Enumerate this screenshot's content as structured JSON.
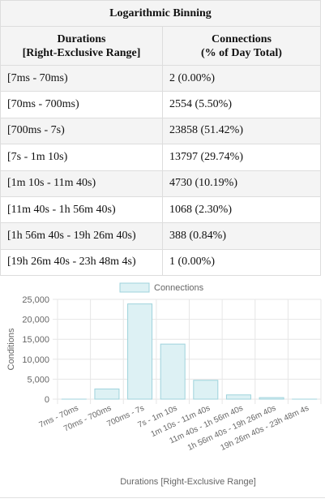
{
  "table": {
    "title": "Logarithmic Binning",
    "col1_line1": "Durations",
    "col1_line2": "[Right-Exclusive Range]",
    "col2_line1": "Connections",
    "col2_line2": "(% of Day Total)",
    "rows": [
      {
        "range": "[7ms - 70ms)",
        "value": "2 (0.00%)"
      },
      {
        "range": "[70ms - 700ms)",
        "value": "2554 (5.50%)"
      },
      {
        "range": "[700ms - 7s)",
        "value": "23858 (51.42%)"
      },
      {
        "range": "[7s - 1m 10s)",
        "value": "13797 (29.74%)"
      },
      {
        "range": "[1m 10s - 11m 40s)",
        "value": "4730 (10.19%)"
      },
      {
        "range": "[11m 40s - 1h 56m 40s)",
        "value": "1068 (2.30%)"
      },
      {
        "range": "[1h 56m 40s - 19h 26m 40s)",
        "value": "388 (0.84%)"
      },
      {
        "range": "[19h 26m 40s - 23h 48m 4s)",
        "value": "1 (0.00%)"
      }
    ]
  },
  "chart_data": {
    "type": "bar",
    "categories": [
      "7ms - 70ms",
      "70ms - 700ms",
      "700ms - 7s",
      "7s - 1m 10s",
      "1m 10s - 11m 40s",
      "11m 40s - 1h 56m 40s",
      "1h 56m 40s - 19h 26m 40s",
      "19h 26m 40s - 23h 48m 4s"
    ],
    "series": [
      {
        "name": "Connections",
        "values": [
          2,
          2554,
          23858,
          13797,
          4730,
          1068,
          388,
          1
        ]
      }
    ],
    "xlabel": "Durations [Right-Exclusive Range]",
    "ylabel": "Conditions",
    "ylim": [
      0,
      25000
    ],
    "yticks": [
      "0",
      "5,000",
      "10,000",
      "15,000",
      "20,000",
      "25,000"
    ],
    "legend": "top",
    "grid": true,
    "colors": {
      "bar_fill": "#ddf1f4",
      "bar_stroke": "#9fd3dc",
      "grid": "#e6e6e6",
      "text": "#666666"
    }
  }
}
